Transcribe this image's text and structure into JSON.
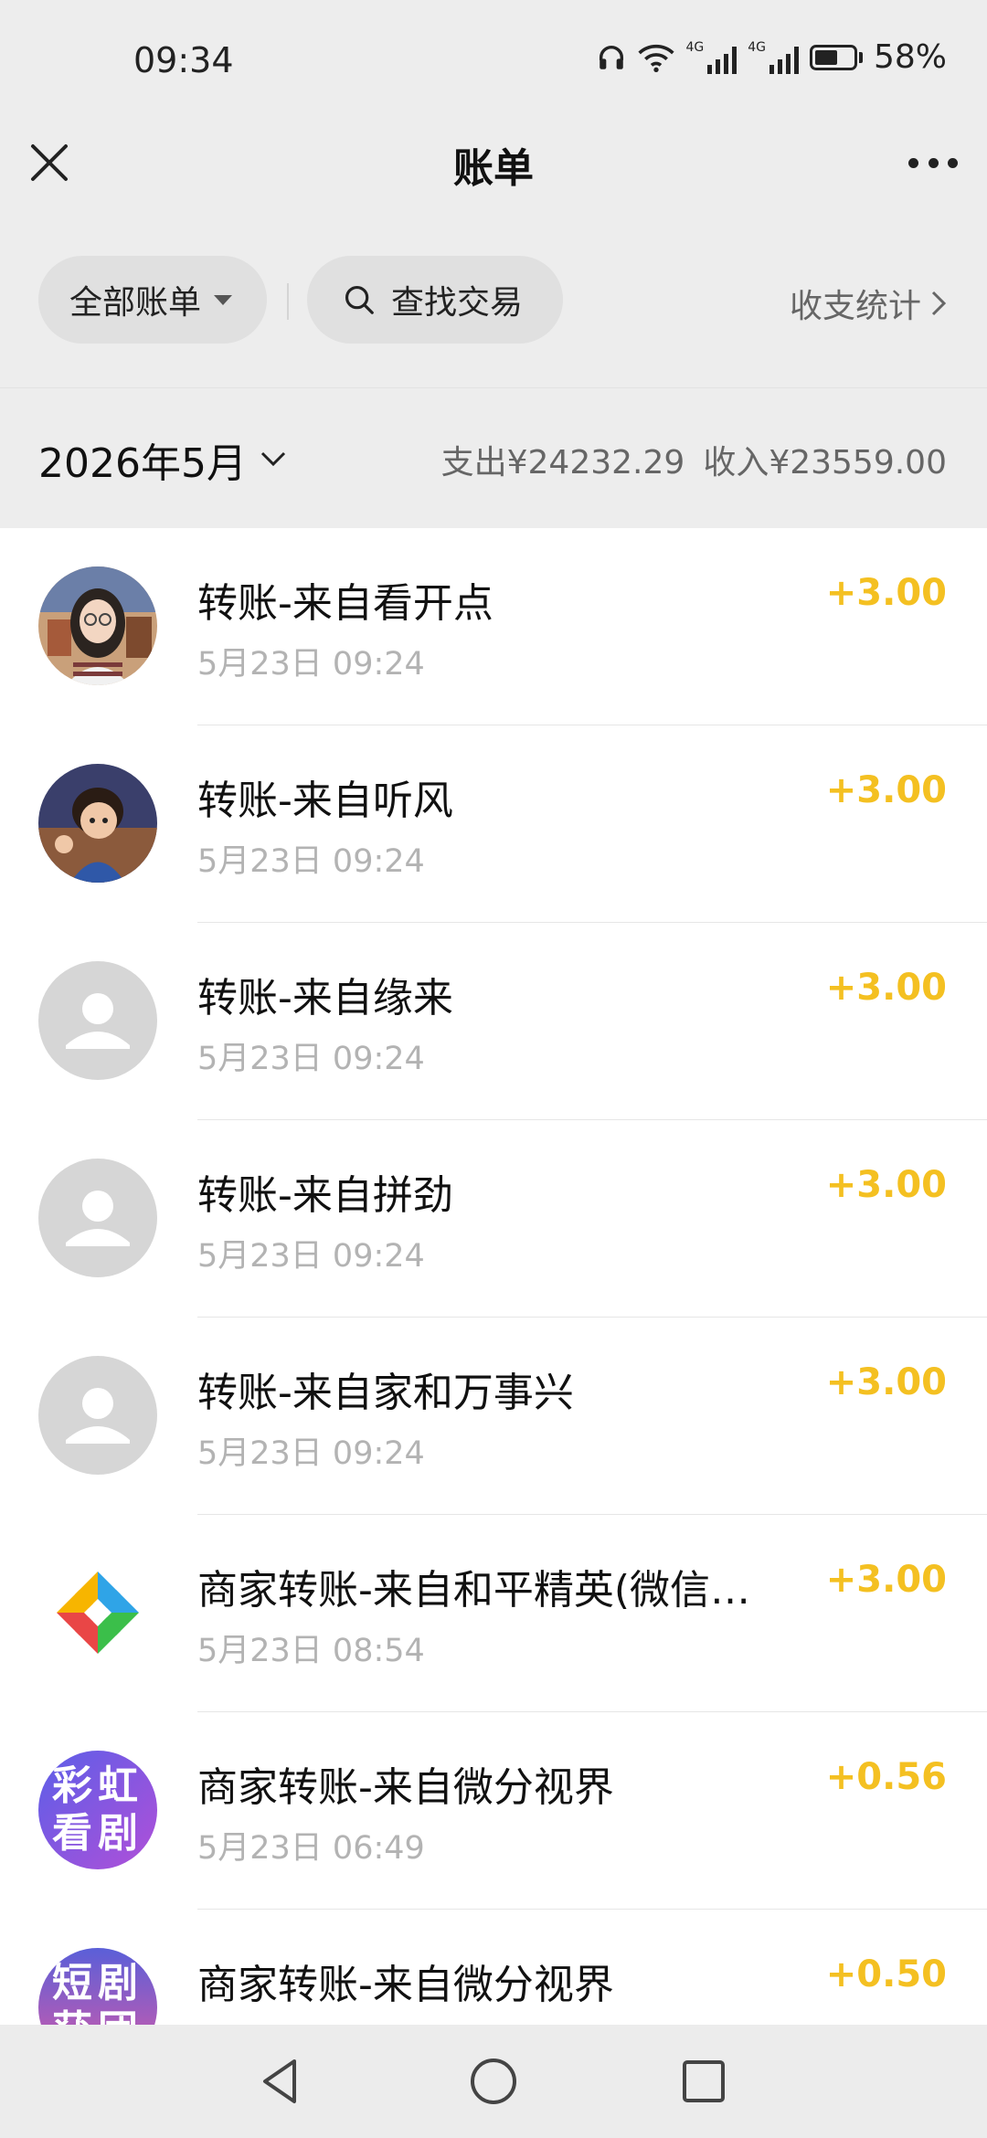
{
  "status_bar": {
    "time": "09:34",
    "battery": "58%",
    "net1": "4G",
    "net2": "4G"
  },
  "header": {
    "title": "账单",
    "close_icon": "close-icon",
    "more_icon": "more-icon"
  },
  "filter": {
    "all_bills": "全部账单",
    "search": "查找交易",
    "stats": "收支统计"
  },
  "month": {
    "label": "2026年5月",
    "expense": "支出¥24232.29",
    "income": "收入¥23559.00"
  },
  "colors": {
    "amount": "#f4c021",
    "background": "#ededed"
  },
  "transactions": [
    {
      "title": "转账-来自看开点",
      "time": "5月23日 09:24",
      "amount": "+3.00"
    },
    {
      "title": "转账-来自听风",
      "time": "5月23日 09:24",
      "amount": "+3.00"
    },
    {
      "title": "转账-来自缘来",
      "time": "5月23日 09:24",
      "amount": "+3.00"
    },
    {
      "title": "转账-来自拼劲",
      "time": "5月23日 09:24",
      "amount": "+3.00"
    },
    {
      "title": "转账-来自家和万事兴",
      "time": "5月23日 09:24",
      "amount": "+3.00"
    },
    {
      "title": "商家转账-来自和平精英(微信…",
      "time": "5月23日 08:54",
      "amount": "+3.00"
    },
    {
      "title": "商家转账-来自微分视界",
      "time": "5月23日 06:49",
      "amount": "+0.56",
      "avatar_text": [
        "彩虹",
        "看剧"
      ]
    },
    {
      "title": "商家转账-来自微分视界",
      "time": "",
      "amount": "+0.50",
      "avatar_text": [
        "短剧",
        "获团"
      ]
    }
  ]
}
